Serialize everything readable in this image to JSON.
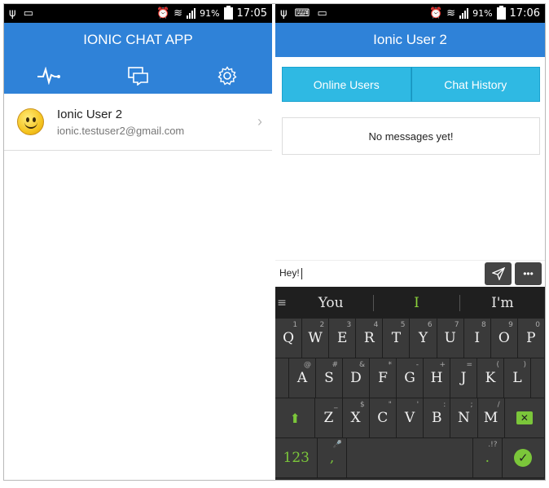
{
  "left": {
    "status": {
      "time": "17:05",
      "battery": "91%"
    },
    "app_title": "IONIC CHAT APP",
    "tabs": [
      {
        "icon": "pulse-icon"
      },
      {
        "icon": "chat-bubbles-icon"
      },
      {
        "icon": "gear-icon"
      }
    ],
    "users": [
      {
        "name": "Ionic User 2",
        "email": "ionic.testuser2@gmail.com"
      }
    ]
  },
  "right": {
    "status": {
      "time": "17:06",
      "battery": "91%"
    },
    "title": "Ionic User 2",
    "segments": [
      "Online Users",
      "Chat History"
    ],
    "empty_message": "No messages yet!",
    "input_value": "Hey!",
    "send_icon": "paper-plane-icon",
    "more_label": "•••",
    "keyboard": {
      "suggestions": [
        "You",
        "I",
        "I'm"
      ],
      "row1": [
        [
          "Q",
          "1"
        ],
        [
          "W",
          "2"
        ],
        [
          "E",
          "3"
        ],
        [
          "R",
          "4"
        ],
        [
          "T",
          "5"
        ],
        [
          "Y",
          "6"
        ],
        [
          "U",
          "7"
        ],
        [
          "I",
          "8"
        ],
        [
          "O",
          "9"
        ],
        [
          "P",
          "0"
        ]
      ],
      "row2": [
        [
          "A",
          "@"
        ],
        [
          "S",
          "#"
        ],
        [
          "D",
          "&"
        ],
        [
          "F",
          "*"
        ],
        [
          "G",
          "-"
        ],
        [
          "H",
          "+"
        ],
        [
          "J",
          "="
        ],
        [
          "K",
          "("
        ],
        [
          "L",
          ")"
        ]
      ],
      "row3": [
        [
          "Z",
          "_"
        ],
        [
          "X",
          "$"
        ],
        [
          "C",
          "\""
        ],
        [
          "V",
          "'"
        ],
        [
          "B",
          ":"
        ],
        [
          "N",
          ";"
        ],
        [
          "M",
          "/"
        ]
      ],
      "mode_label": "123",
      "comma": ",",
      "period": ".",
      "punct_hint": ".!?"
    }
  },
  "colors": {
    "appbar": "#2f82d8",
    "segment": "#2fb9e3",
    "keyboard_accent": "#7bc63a"
  }
}
